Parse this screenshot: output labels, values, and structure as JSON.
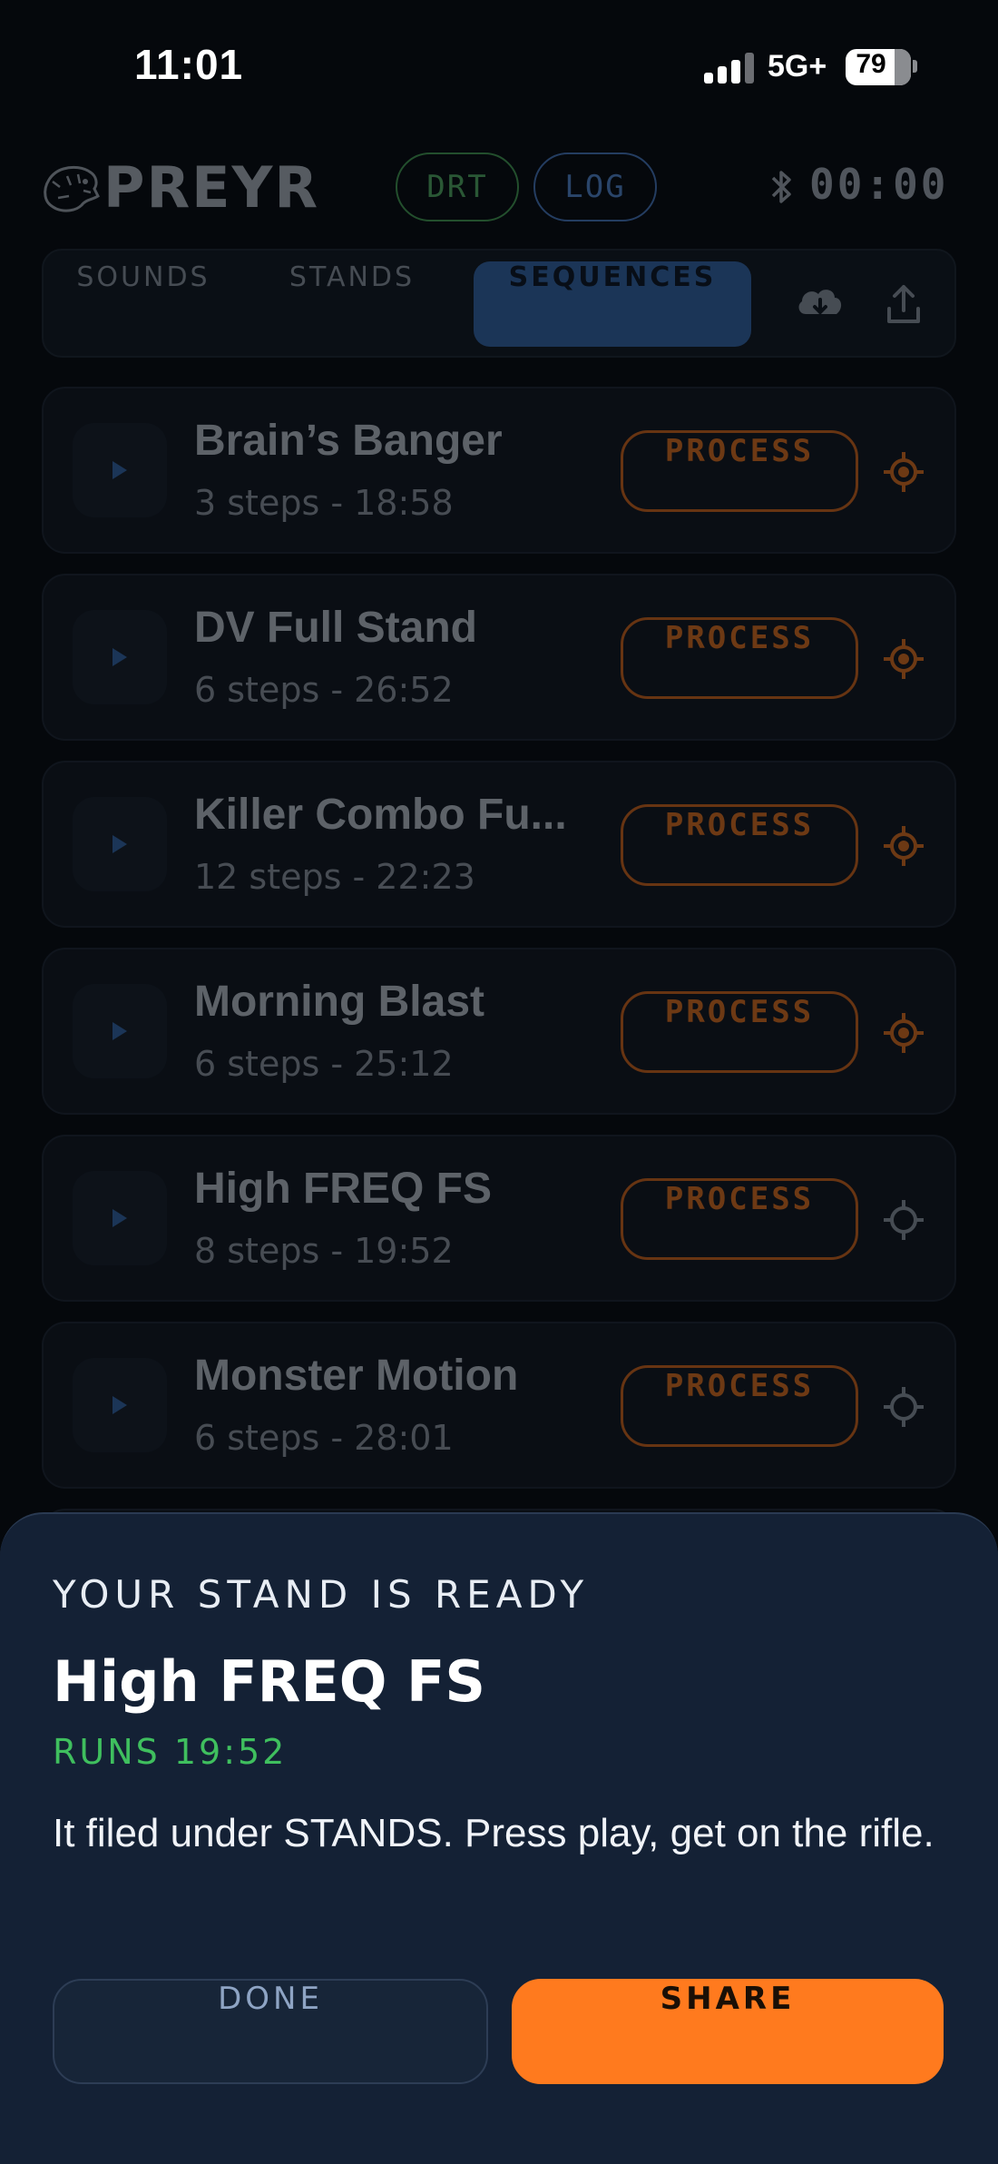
{
  "status_bar": {
    "time": "11:01",
    "network": "5G+",
    "battery": "79",
    "battery_level": 0.79
  },
  "header": {
    "logo": "PREYR",
    "drt_label": "DRT",
    "log_label": "LOG",
    "timer": "00:00"
  },
  "tabs": {
    "sounds": "SOUNDS",
    "stands": "STANDS",
    "sequences": "SEQUENCES",
    "active": "SEQUENCES"
  },
  "sequences": [
    {
      "title": "Brain’s Banger",
      "subtitle": "3 steps - 18:58",
      "action": "PROCESS",
      "target_active": true
    },
    {
      "title": "DV Full Stand",
      "subtitle": "6 steps - 26:52",
      "action": "PROCESS",
      "target_active": true
    },
    {
      "title": "Killer Combo Fu...",
      "subtitle": "12 steps - 22:23",
      "action": "PROCESS",
      "target_active": true
    },
    {
      "title": "Morning Blast",
      "subtitle": "6 steps - 25:12",
      "action": "PROCESS",
      "target_active": true
    },
    {
      "title": "High FREQ FS",
      "subtitle": "8 steps - 19:52",
      "action": "PROCESS",
      "target_active": false
    },
    {
      "title": "Monster Motion",
      "subtitle": "6 steps - 28:01",
      "action": "PROCESS",
      "target_active": false
    }
  ],
  "sheet": {
    "kicker": "YOUR STAND IS READY",
    "title": "High FREQ FS",
    "runs": "RUNS 19:52",
    "body": "It filed under STANDS. Press play, get on the rifle.",
    "done_label": "DONE",
    "share_label": "SHARE"
  },
  "colors": {
    "accent": "#ff7a1e",
    "active_tab": "#2e5c95",
    "success": "#3fbf5e",
    "sheet_bg": "#142135"
  }
}
